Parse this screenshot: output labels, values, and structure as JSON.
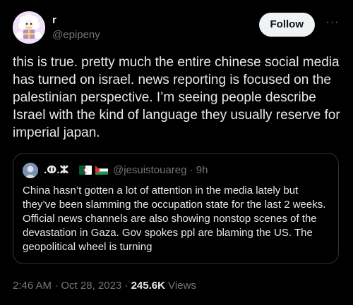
{
  "author": {
    "display_name": "r",
    "handle": "@epipeny",
    "avatar_icon": "sheep-with-gift-icon"
  },
  "actions": {
    "follow_label": "Follow",
    "more_label": "···"
  },
  "tweet": {
    "text": "this is true. pretty much the entire chinese social media has turned on israel. news reporting is focused on the palestinian perspective. I’m seeing people describe Israel with the kind of language they usually reserve for imperial japan."
  },
  "quoted_tweet": {
    "display_name": ".ⵀ.ⵣ",
    "flags": [
      "algeria-flag-icon",
      "palestine-flag-icon"
    ],
    "handle_time": "@jesuistouareg · 9h",
    "text": "China hasn’t gotten a lot of attention in the media lately but they’ve been slamming the occupation state for the last 2 weeks. Official news channels are also showing nonstop scenes of the devastation in Gaza. Gov spokes ppl are blaming the US. The geopolitical wheel is turning"
  },
  "meta": {
    "timestamp": "2:46 AM · Oct 28, 2023 · ",
    "views_count": "245.6K",
    "views_label": " Views"
  },
  "colors": {
    "background": "#000000",
    "text_primary": "#e7e9ea",
    "text_secondary": "#71767b",
    "border": "#2f3336",
    "follow_bg": "#eff3f4"
  }
}
